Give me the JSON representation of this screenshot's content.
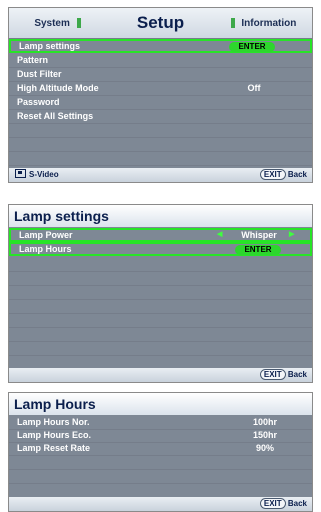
{
  "setup_panel": {
    "tabs": [
      "System",
      "Setup",
      "Information"
    ],
    "items": [
      {
        "label": "Lamp settings",
        "value": "ENTER"
      },
      {
        "label": "Pattern",
        "value": ""
      },
      {
        "label": "Dust Filter",
        "value": ""
      },
      {
        "label": "High Altitude Mode",
        "value": "Off"
      },
      {
        "label": "Password",
        "value": ""
      },
      {
        "label": "Reset All Settings",
        "value": ""
      }
    ],
    "footer_source": "S-Video",
    "exit_label": "EXIT",
    "back_label": "Back"
  },
  "lamp_settings_panel": {
    "title": "Lamp settings",
    "items": [
      {
        "label": "Lamp Power",
        "value": "Whisper"
      },
      {
        "label": "Lamp Hours",
        "value": "ENTER"
      }
    ],
    "exit_label": "EXIT",
    "back_label": "Back"
  },
  "lamp_hours_panel": {
    "title": "Lamp Hours",
    "items": [
      {
        "label": "Lamp Hours Nor.",
        "value": "100hr"
      },
      {
        "label": "Lamp Hours Eco.",
        "value": "150hr"
      },
      {
        "label": "Lamp Reset Rate",
        "value": "90%"
      }
    ],
    "exit_label": "EXIT",
    "back_label": "Back"
  },
  "colors": {
    "highlight": "#27e427",
    "menu_body": "#7e8895",
    "title_text": "#0b1f4d"
  },
  "icons": [
    "source-icon",
    "left-arrow-icon",
    "right-arrow-icon"
  ]
}
